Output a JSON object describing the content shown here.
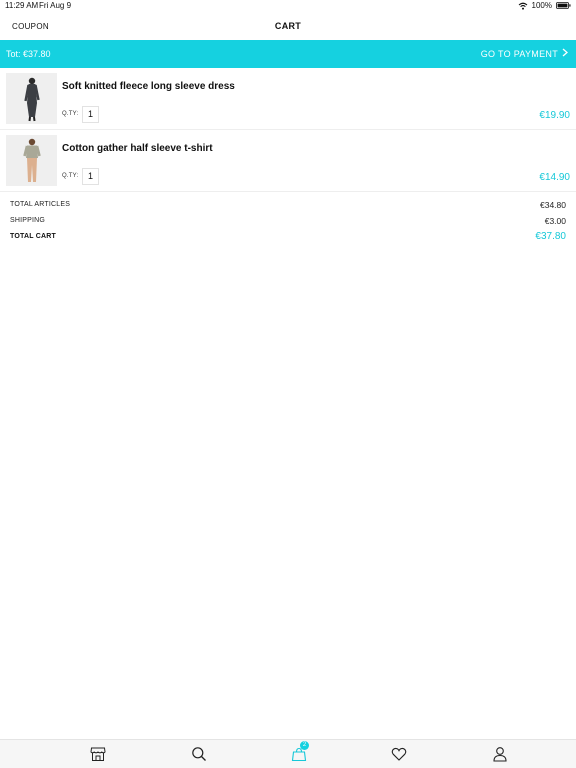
{
  "status_bar": {
    "time": "11:29 AM",
    "date": "Fri Aug 9",
    "battery": "100%"
  },
  "nav": {
    "coupon_label": "COUPON",
    "title": "CART"
  },
  "total_bar": {
    "total_text": "Tot: €37.80",
    "payment_label": "GO TO PAYMENT"
  },
  "cart": {
    "qty_label": "Q.TY:",
    "items": [
      {
        "name": "Soft knitted fleece long sleeve dress",
        "qty": "1",
        "price": "€19.90"
      },
      {
        "name": "Cotton gather half sleeve t-shirt",
        "qty": "1",
        "price": "€14.90"
      }
    ]
  },
  "summary": {
    "articles_label": "TOTAL ARTICLES",
    "articles_value": "€34.80",
    "shipping_label": "SHIPPING",
    "shipping_value": "€3.00",
    "total_label": "TOTAL CART",
    "total_value": "€37.80"
  },
  "tab_bar": {
    "cart_badge": "2",
    "icons": [
      "store-icon",
      "search-icon",
      "bag-icon",
      "heart-icon",
      "user-icon"
    ]
  },
  "colors": {
    "accent": "#15d1e0",
    "price": "#15c8d8"
  }
}
